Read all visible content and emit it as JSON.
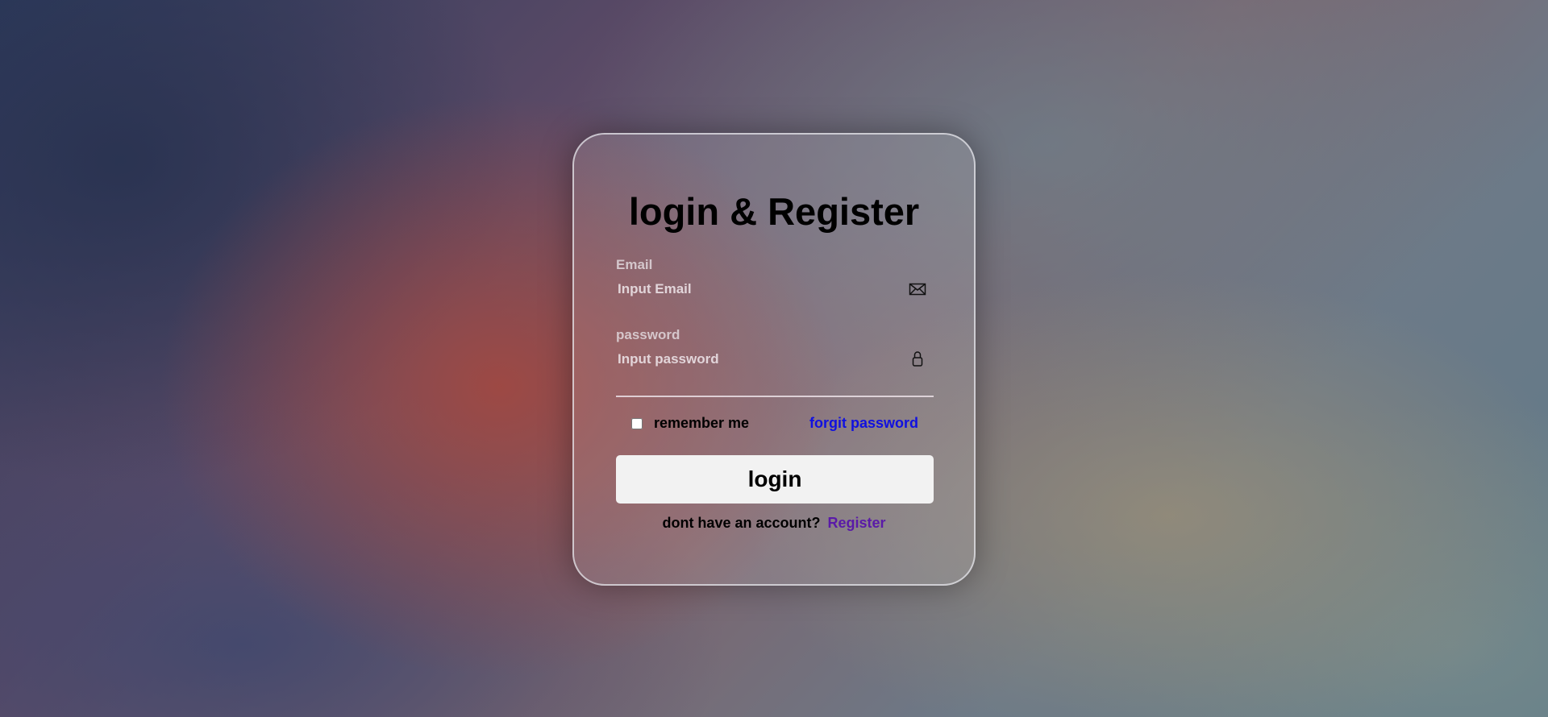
{
  "form": {
    "title": "login & Register",
    "email": {
      "label": "Email",
      "placeholder": "Input Email",
      "value": "",
      "icon": "mail-icon"
    },
    "password": {
      "label": "password",
      "placeholder": "Input password",
      "value": "",
      "icon": "lock-icon"
    },
    "remember_label": "remember me",
    "remember_checked": false,
    "forgot_label": "forgit password",
    "login_label": "login",
    "register_prompt": "dont have an account?",
    "register_label": "Register"
  },
  "colors": {
    "forgot_link": "#1010e0",
    "register_link": "#5a1aa8",
    "button_bg": "#f2f2f2"
  }
}
